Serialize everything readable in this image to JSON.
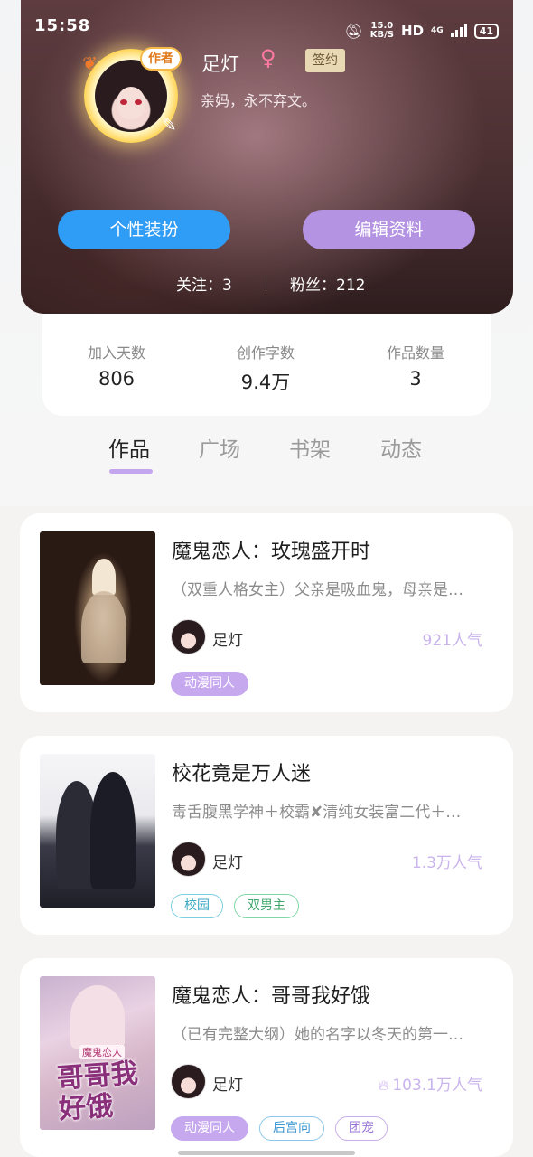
{
  "status_bar": {
    "time": "15:58",
    "net_speed": "15.0",
    "net_unit": "KB/S",
    "hd": "HD",
    "network": "4G",
    "battery": "41"
  },
  "profile": {
    "author_badge": "作者",
    "username": "足灯",
    "gender_symbol": "♀",
    "signed_badge": "签约",
    "bio": "亲妈，永不弃文。",
    "dress_button": "个性装扮",
    "edit_button": "编辑资料",
    "following": "关注：3",
    "followers": "粉丝：212"
  },
  "stats": [
    {
      "label": "加入天数",
      "value": "806"
    },
    {
      "label": "创作字数",
      "value": "9.4万"
    },
    {
      "label": "作品数量",
      "value": "3"
    }
  ],
  "tabs": [
    "作品",
    "广场",
    "书架",
    "动态"
  ],
  "works": [
    {
      "title": "魔鬼恋人：玫瑰盛开时",
      "desc": "（双重人格女主）父亲是吸血鬼，母亲是…",
      "author": "足灯",
      "popularity": "921人气",
      "tags": [
        "动漫同人"
      ]
    },
    {
      "title": "校花竟是万人迷",
      "desc": "毒舌腹黑学神＋校霸✘清纯女装富二代＋…",
      "author": "足灯",
      "popularity": "1.3万人气",
      "tags": [
        "校园",
        "双男主"
      ]
    },
    {
      "title": "魔鬼恋人：哥哥我好饿",
      "desc": "（已有完整大纲）她的名字以冬天的第一…",
      "author": "足灯",
      "popularity": "103.1万人气",
      "cover_series": "魔鬼恋人",
      "cover_title": "哥哥我好饿",
      "tags": [
        "动漫同人",
        "后宫向",
        "团宠"
      ]
    }
  ],
  "colors": {
    "accent_purple": "#b493e3",
    "accent_blue": "#2f9cf5",
    "popularity": "#c9b4ec"
  }
}
